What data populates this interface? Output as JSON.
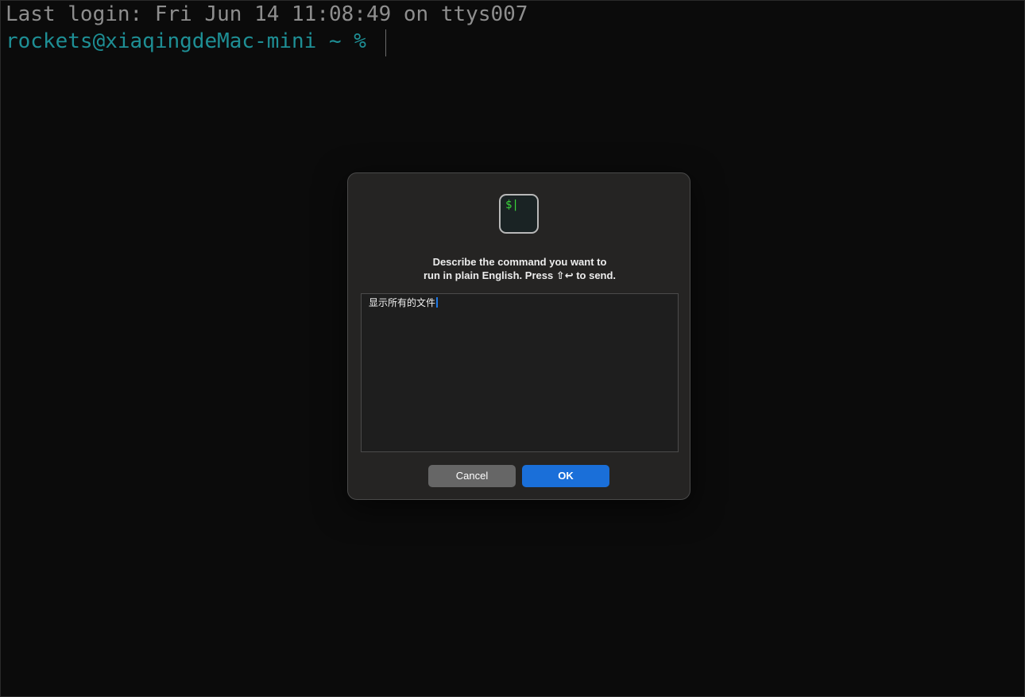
{
  "terminal": {
    "last_login": "Last login: Fri Jun 14 11:08:49 on ttys007",
    "prompt": "rockets@xiaqingdeMac-mini ~ %"
  },
  "dialog": {
    "icon": "terminal-icon",
    "icon_glyph": "$|",
    "message_line1": "Describe the command you want to",
    "message_line2": "run in plain English. Press ⇧↩ to send.",
    "input_value": "显示所有的文件",
    "cancel_label": "Cancel",
    "ok_label": "OK"
  },
  "colors": {
    "background": "#0b0b0b",
    "prompt": "#1e8f95",
    "login_text": "#8e8e8e",
    "ok_button": "#1a6fd9",
    "cancel_button": "#666666"
  }
}
